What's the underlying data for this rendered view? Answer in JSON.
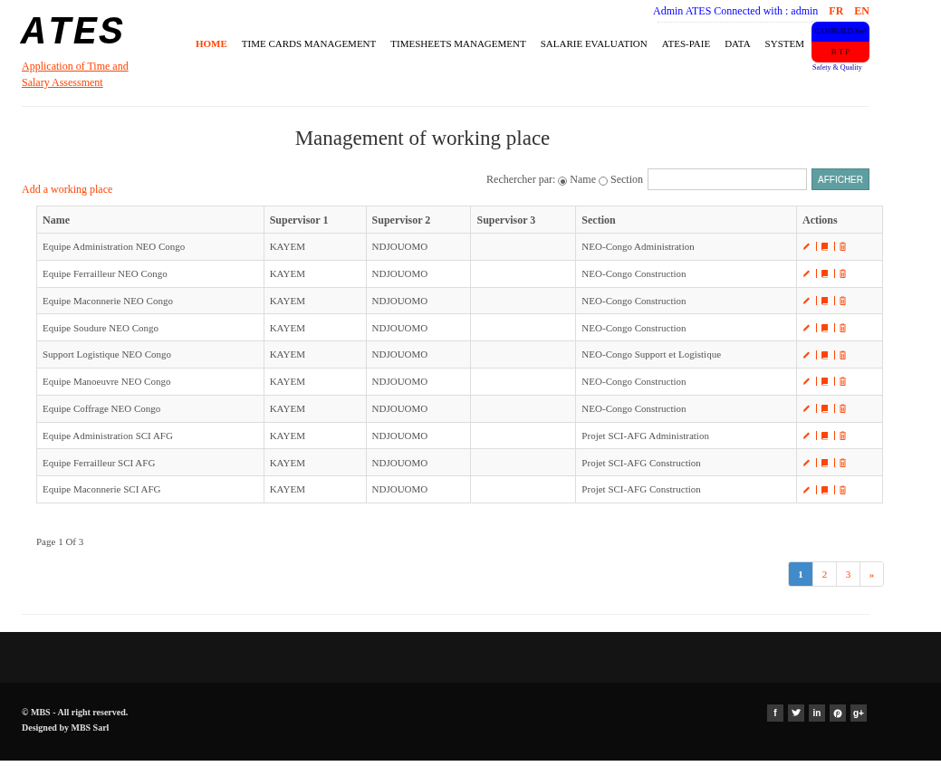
{
  "header": {
    "logo": "ATES",
    "tagline_lines": [
      "Application of Time and",
      "Salary Assessment"
    ],
    "connected_text": "Admin ATES Connected with : admin",
    "languages": [
      "FR",
      "EN"
    ],
    "nav": [
      {
        "label": "HOME",
        "selected": true
      },
      {
        "label": "TIME CARDS MANAGEMENT",
        "selected": false
      },
      {
        "label": "TIMESHEETS MANAGEMENT",
        "selected": false
      },
      {
        "label": "SALARIE EVALUATION",
        "selected": false
      },
      {
        "label": "ATES-PAIE",
        "selected": false
      },
      {
        "label": "DATA",
        "selected": false
      },
      {
        "label": "SYSTEM",
        "selected": false
      }
    ],
    "company_logo": {
      "name": "CAMBUILD Sarl",
      "subtitle": "B T P",
      "slogan": "Safety & Quality"
    }
  },
  "page_title": "Management of working place",
  "add_link": "Add a working place",
  "search": {
    "label": "Rechercher par:",
    "options": [
      {
        "label": "Name",
        "selected": true
      },
      {
        "label": "Section",
        "selected": false
      }
    ],
    "button": "AFFICHER"
  },
  "table": {
    "columns": [
      "Name",
      "Supervisor 1",
      "Supervisor 2",
      "Supervisor 3",
      "Section",
      "Actions"
    ],
    "rows": [
      [
        "Equipe Administration NEO Congo",
        "KAYEM",
        "NDJOUOMO",
        "",
        "NEO-Congo Administration"
      ],
      [
        "Equipe Ferrailleur NEO Congo",
        "KAYEM",
        "NDJOUOMO",
        "",
        "NEO-Congo Construction"
      ],
      [
        "Equipe Maconnerie NEO Congo",
        "KAYEM",
        "NDJOUOMO",
        "",
        "NEO-Congo Construction"
      ],
      [
        "Equipe Soudure NEO Congo",
        "KAYEM",
        "NDJOUOMO",
        "",
        "NEO-Congo Construction"
      ],
      [
        "Support Logistique NEO Congo",
        "KAYEM",
        "NDJOUOMO",
        "",
        "NEO-Congo Support et Logistique"
      ],
      [
        "Equipe Manoeuvre NEO Congo",
        "KAYEM",
        "NDJOUOMO",
        "",
        "NEO-Congo Construction"
      ],
      [
        "Equipe Coffrage NEO Congo",
        "KAYEM",
        "NDJOUOMO",
        "",
        "NEO-Congo Construction"
      ],
      [
        "Equipe Administration SCI AFG",
        "KAYEM",
        "NDJOUOMO",
        "",
        "Projet SCI-AFG Administration"
      ],
      [
        "Equipe Ferrailleur SCI AFG",
        "KAYEM",
        "NDJOUOMO",
        "",
        "Projet SCI-AFG Construction"
      ],
      [
        "Equipe Maconnerie SCI AFG",
        "KAYEM",
        "NDJOUOMO",
        "",
        "Projet SCI-AFG Construction"
      ]
    ]
  },
  "page_info": "Page 1 Of 3",
  "pagination": [
    {
      "label": "1",
      "selected": true
    },
    {
      "label": "2",
      "selected": false
    },
    {
      "label": "3",
      "selected": false
    },
    {
      "label": "»",
      "selected": false
    }
  ],
  "footer": {
    "lines": [
      "© MBS - All right reserved.",
      "Designed by MBS Sarl"
    ],
    "social": [
      {
        "kind": "text",
        "label": "f"
      },
      {
        "kind": "bird"
      },
      {
        "kind": "text",
        "label": "in"
      },
      {
        "kind": "pin"
      },
      {
        "kind": "text",
        "label": "g+"
      }
    ]
  }
}
